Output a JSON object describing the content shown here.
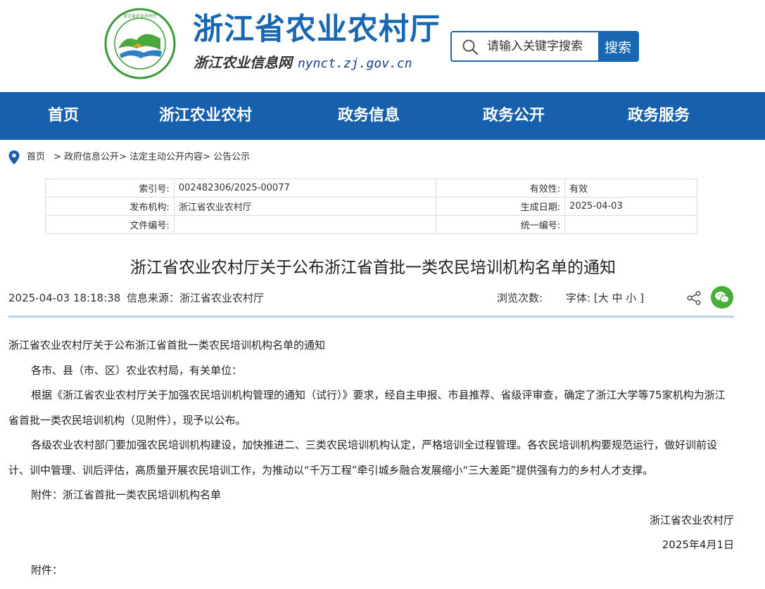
{
  "header": {
    "logo_alt": "ZHEJIANG AGRICULTURE AND RURAL AFFAIRS",
    "title": "浙江省农业农村厅",
    "subtitle": "浙江农业信息网",
    "url": "nynct.zj.gov.cn",
    "search_placeholder": "请输入关键字搜索",
    "search_button": "搜索"
  },
  "nav": {
    "items": [
      "首页",
      "浙江农业农村",
      "政务信息",
      "政务公开",
      "政务服务"
    ]
  },
  "breadcrumb": {
    "home": "首页",
    "path": "> 政府信息公开> 法定主动公开内容> 公告公示"
  },
  "info": {
    "rows": [
      {
        "k1": "索引号:",
        "v1": "002482306/2025-00077",
        "k2": "有效性:",
        "v2": "有效"
      },
      {
        "k1": "发布机构:",
        "v1": "浙江省农业农村厅",
        "k2": "生成日期:",
        "v2": "2025-04-03"
      },
      {
        "k1": "文件编号:",
        "v1": "",
        "k2": "统一编号:",
        "v2": ""
      }
    ]
  },
  "article": {
    "title": "浙江省农业农村厅关于公布浙江省首批一类农民培训机构名单的通知",
    "datetime": "2025-04-03 18:18:38",
    "source": "信息来源：浙江省农业农村厅",
    "views": "浏览次数:",
    "font_label": "字体: [",
    "font_large": "大",
    "font_medium": "中",
    "font_small": "小",
    "font_close": "]",
    "paragraphs": [
      "浙江省农业农村厅关于公布浙江省首批一类农民培训机构名单的通知",
      "各市、县（市、区）农业农村局，有关单位：",
      "根据《浙江省农业农村厅关于加强农民培训机构管理的通知（试行）》要求，经自主申报、市县推荐、省级评审查，确定了浙江大学等75家机构为浙江省首批一类农民培训机构（见附件），现予以公布。",
      "各级农业农村部门要加强农民培训机构建设，加快推进二、三类农民培训机构认定，严格培训全过程管理。各农民培训机构要规范运行，做好训前设计、训中管理、训后评估，高质量开展农民培训工作，为推动以“千万工程”牵引城乡融合发展缩小“三大差距”提供强有力的乡村人才支撑。",
      "附件：浙江省首批一类农民培训机构名单"
    ],
    "signature": "浙江省农业农村厅",
    "sign_date": "2025年4月1日",
    "attachment_label": "附件："
  }
}
